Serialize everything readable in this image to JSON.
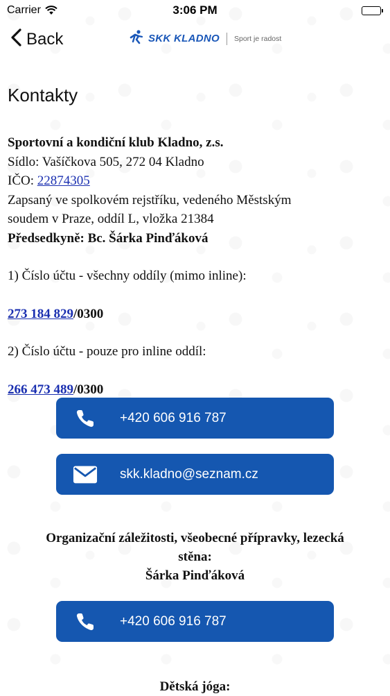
{
  "status_bar": {
    "carrier": "Carrier",
    "time": "3:06 PM",
    "icons": [
      "wifi-icon",
      "battery-icon"
    ]
  },
  "nav": {
    "back_label": "Back",
    "logo_name": "SKK KLADNO",
    "logo_tagline": "Sport je radost"
  },
  "page": {
    "title": "Kontakty",
    "org_name": "Sportovní a kondiční klub Kladno, z.s.",
    "address": "Sídlo: Vašíčkova 505, 272 04  Kladno",
    "ico_label": "IČO: ",
    "ico_value": "22874305",
    "registry_line1": "Zapsaný ve spolkovém rejstříku, vedeného Městským",
    "registry_line2": "soudem v Praze, oddíl L, vložka 21384",
    "chairperson": "Předsedkyně: Bc. Šárka Pinďáková",
    "account1_label": "1) Číslo účtu - všechny oddíly (mimo inline):",
    "account1_number": "273 184 829",
    "account1_bank": "/0300",
    "account2_label": "2) Číslo účtu - pouze pro inline oddíl:",
    "account2_number": "266 473 489",
    "account2_bank": "/0300"
  },
  "buttons": {
    "phone_main": "+420 606 916 787",
    "email_main": "skk.kladno@seznam.cz",
    "phone_org": "+420 606 916 787"
  },
  "sections": {
    "org_heading_line1": "Organizační záležitosti, všeobecné přípravky, lezecká",
    "org_heading_line2": "stěna:",
    "org_person": "Šárka Pinďáková",
    "yoga_heading": "Dětská jóga:"
  },
  "colors": {
    "accent": "#1557b0",
    "link": "#1a2fb0",
    "brand": "#1a57b8"
  }
}
